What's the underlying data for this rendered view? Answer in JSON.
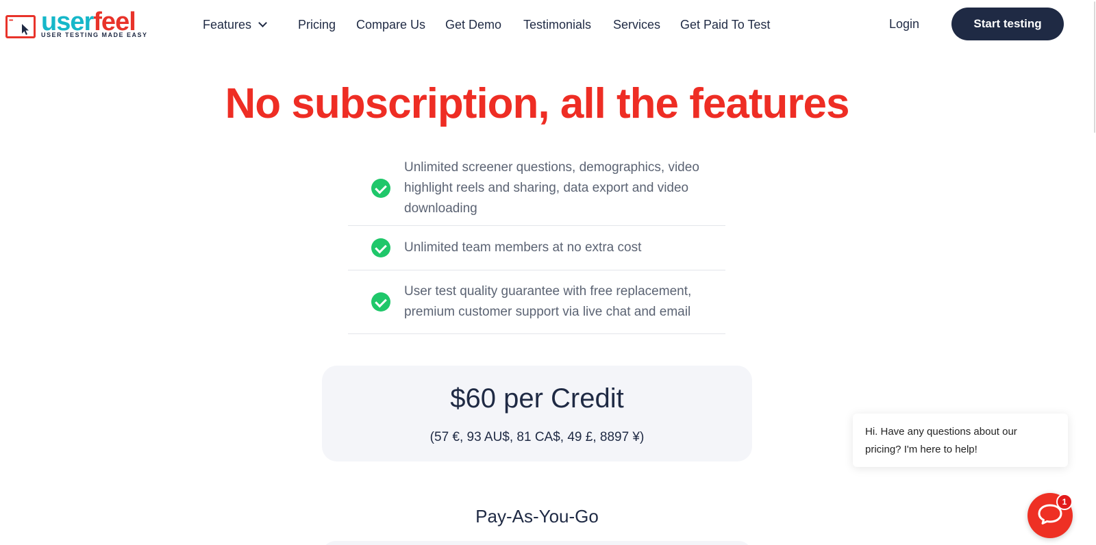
{
  "logo": {
    "word_user": "user",
    "word_feel": "feel",
    "tagline": "USER TESTING MADE EASY",
    "icon": "browser-cursor-icon"
  },
  "nav": {
    "items": [
      {
        "label": "Features",
        "has_dropdown": true
      },
      {
        "label": "Pricing"
      },
      {
        "label": "Compare Us"
      },
      {
        "label": "Get Demo"
      },
      {
        "label": "Testimonials"
      },
      {
        "label": "Services"
      },
      {
        "label": "Get Paid To Test"
      }
    ],
    "login": "Login",
    "cta": "Start testing"
  },
  "hero": {
    "headline": "No subscription, all the features"
  },
  "features": [
    "Unlimited screener questions, demographics, video highlight reels and sharing, data export and video downloading",
    "Unlimited team members at no extra cost",
    "User test quality guarantee with free replacement, premium customer support via live chat and email"
  ],
  "price": {
    "main": "$60 per Credit",
    "conversions": "(57 €, 93 AU$, 81 CA$, 49 £, 8897 ¥)"
  },
  "plan": {
    "title": "Pay-As-You-Go"
  },
  "chat": {
    "message": "Hi. Have any questions about our pricing? I'm here to help!",
    "badge_count": "1"
  },
  "colors": {
    "brand_red": "#ee2d24",
    "brand_cyan": "#16b7c9",
    "navy": "#1f2a44",
    "check_green": "#1fc76a",
    "card_bg": "#f4f5f9"
  }
}
